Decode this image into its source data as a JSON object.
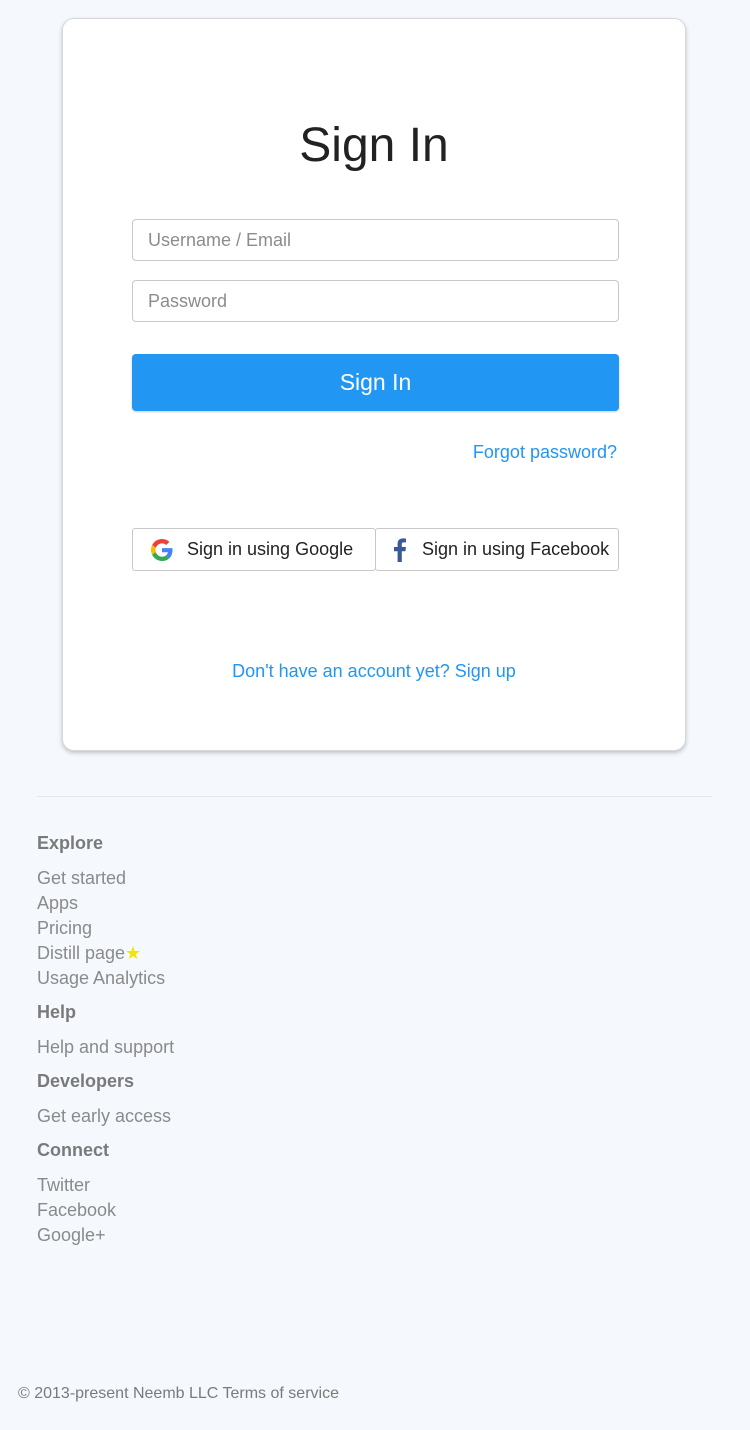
{
  "signin": {
    "title": "Sign In",
    "username_placeholder": "Username / Email",
    "password_placeholder": "Password",
    "submit_label": "Sign In",
    "forgot_label": "Forgot password?",
    "google_label": "Sign in using Google",
    "facebook_label": "Sign in using Facebook",
    "signup_label": "Don't have an account yet? Sign up"
  },
  "footer": {
    "sections": [
      {
        "heading": "Explore",
        "links": [
          "Get started",
          "Apps",
          "Pricing",
          "Distill page",
          "Usage Analytics"
        ]
      },
      {
        "heading": "Help",
        "links": [
          "Help and support"
        ]
      },
      {
        "heading": "Developers",
        "links": [
          "Get early access"
        ]
      },
      {
        "heading": "Connect",
        "links": [
          "Twitter",
          "Facebook",
          "Google+"
        ]
      }
    ],
    "copyright": "© 2013-present Neemb LLC",
    "terms_label": "Terms of service"
  },
  "colors": {
    "accent": "#2196f3",
    "background": "#f5f9fd",
    "star": "#f2e600",
    "facebook": "#3b5998"
  },
  "icons": {
    "google": "google-icon",
    "facebook": "facebook-icon",
    "star": "star-icon"
  }
}
